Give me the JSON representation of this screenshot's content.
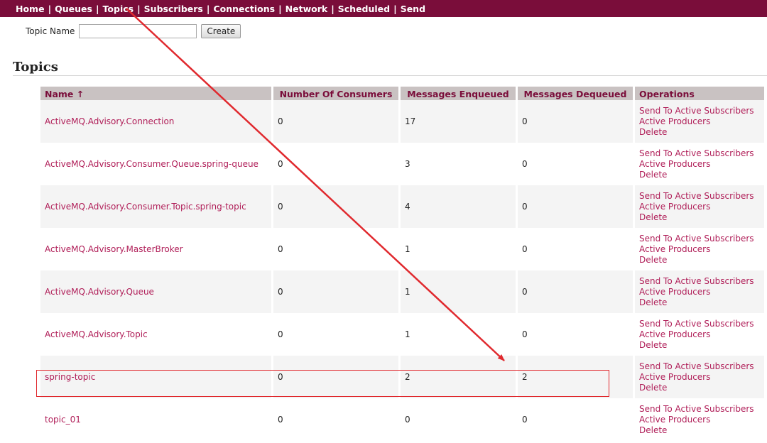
{
  "nav": {
    "items": [
      {
        "label": "Home",
        "id": "home"
      },
      {
        "label": "Queues",
        "id": "queues"
      },
      {
        "label": "Topics",
        "id": "topics"
      },
      {
        "label": "Subscribers",
        "id": "subscribers"
      },
      {
        "label": "Connections",
        "id": "connections"
      },
      {
        "label": "Network",
        "id": "network"
      },
      {
        "label": "Scheduled",
        "id": "scheduled"
      },
      {
        "label": "Send",
        "id": "send"
      }
    ],
    "separator": "|"
  },
  "form": {
    "label": "Topic Name",
    "value": "",
    "button": "Create"
  },
  "section_title": "Topics",
  "table": {
    "headers": {
      "name": "Name ↑",
      "consumers": "Number Of Consumers",
      "enqueued": "Messages Enqueued",
      "dequeued": "Messages Dequeued",
      "operations": "Operations"
    },
    "operations": [
      "Send To Active Subscribers",
      "Active Producers",
      "Delete"
    ],
    "rows": [
      {
        "name": "ActiveMQ.Advisory.Connection",
        "consumers": "0",
        "enqueued": "17",
        "dequeued": "0"
      },
      {
        "name": "ActiveMQ.Advisory.Consumer.Queue.spring-queue",
        "consumers": "0",
        "enqueued": "3",
        "dequeued": "0"
      },
      {
        "name": "ActiveMQ.Advisory.Consumer.Topic.spring-topic",
        "consumers": "0",
        "enqueued": "4",
        "dequeued": "0"
      },
      {
        "name": "ActiveMQ.Advisory.MasterBroker",
        "consumers": "0",
        "enqueued": "1",
        "dequeued": "0"
      },
      {
        "name": "ActiveMQ.Advisory.Queue",
        "consumers": "0",
        "enqueued": "1",
        "dequeued": "0"
      },
      {
        "name": "ActiveMQ.Advisory.Topic",
        "consumers": "0",
        "enqueued": "1",
        "dequeued": "0"
      },
      {
        "name": "spring-topic",
        "consumers": "0",
        "enqueued": "2",
        "dequeued": "2"
      },
      {
        "name": "topic_01",
        "consumers": "0",
        "enqueued": "0",
        "dequeued": "0"
      }
    ]
  },
  "annotations": {
    "arrow_color": "#e0292e",
    "highlight_color": "#e0292e",
    "highlighted_row": "spring-topic"
  },
  "colors": {
    "nav_background": "#7a0d3a",
    "link": "#b01e58",
    "header_background": "#c9c2c2"
  }
}
